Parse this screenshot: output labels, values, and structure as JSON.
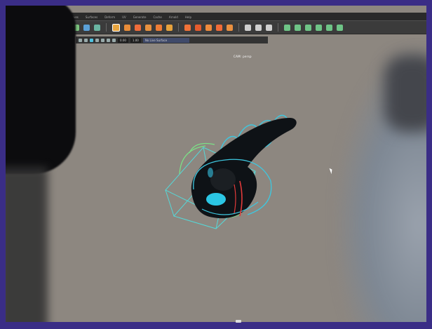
{
  "app": {
    "menus": [
      "Curves",
      "Surfaces",
      "Deform",
      "UV",
      "Generate",
      "Cache",
      "Arnold",
      "Help"
    ],
    "workspace_field": "Symmetry: Off",
    "camera_field": "persp",
    "coord_field": "0.00",
    "value_field": "1.00",
    "active_field": "No Live Surface",
    "viewport_label": "CAM: persp"
  },
  "colors": {
    "accent": "#3ec7df",
    "handle_green": "#7ce087",
    "handle_red": "#e23a3a",
    "background": "#8d8780",
    "border": "#3a2d86"
  },
  "icons": [
    "play-icon",
    "clock-icon",
    "select-icon",
    "move-icon",
    "rotate-icon",
    "scale-icon",
    "snap-icon",
    "magnet-icon",
    "lasso-icon",
    "paint-icon",
    "grid-icon"
  ]
}
